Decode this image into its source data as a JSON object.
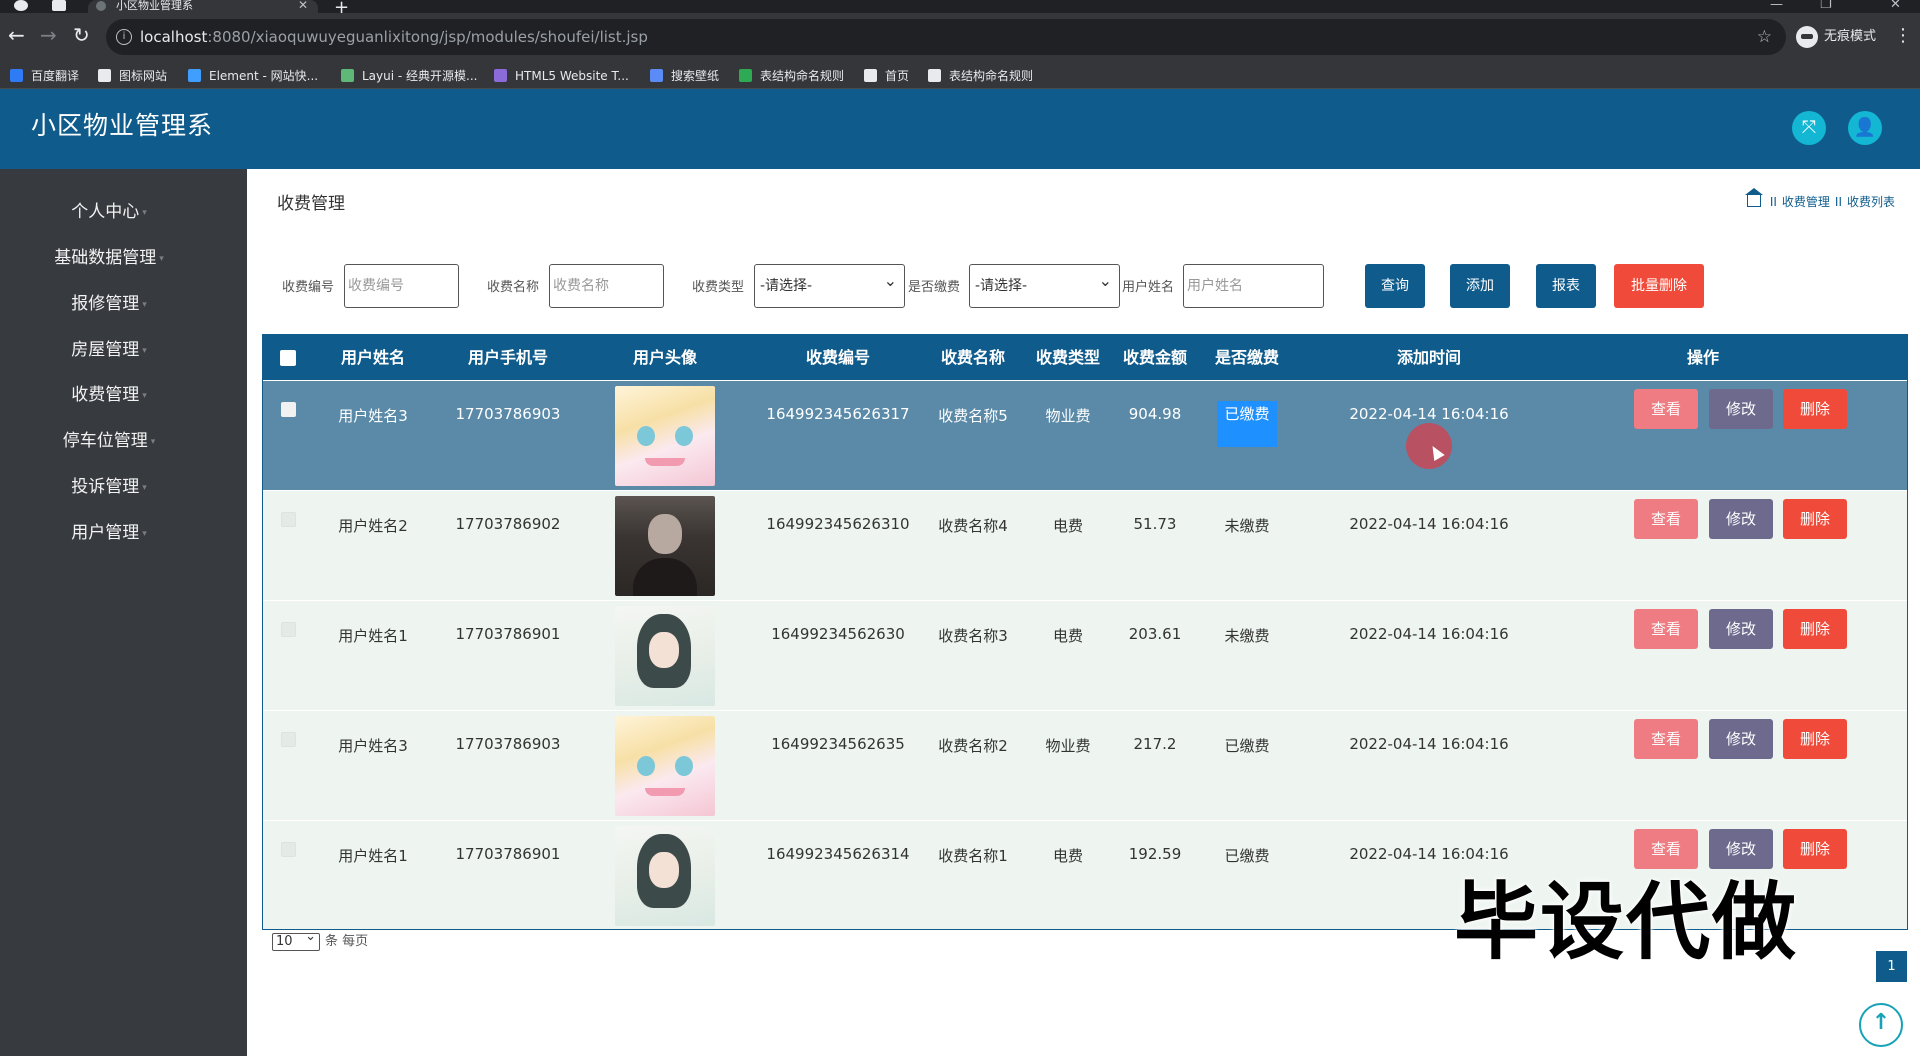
{
  "browser": {
    "tab_title": "小区物业管理系",
    "url_host": "localhost",
    "url_path": ":8080/xiaoquwuyeguanlixitong/jsp/modules/shoufei/list.jsp",
    "incognito_label": "无痕模式",
    "bookmarks": [
      {
        "label": "百度翻译",
        "icon": "translate-icon",
        "color": "#2f7bf6"
      },
      {
        "label": "图标网站",
        "icon": "flag-icon",
        "color": "#e8eaed"
      },
      {
        "label": "Element - 网站快...",
        "icon": "element-icon",
        "color": "#409eff"
      },
      {
        "label": "Layui - 经典开源模...",
        "icon": "layui-icon",
        "color": "#5fb878"
      },
      {
        "label": "HTML5 Website T...",
        "icon": "html5-icon",
        "color": "#8a6bd8"
      },
      {
        "label": "搜索壁纸",
        "icon": "wallpaper-icon",
        "color": "#5b8bf7"
      },
      {
        "label": "表结构命名规则",
        "icon": "sheet-icon",
        "color": "#2eaa55"
      },
      {
        "label": "首页",
        "icon": "globe-icon",
        "color": "#e8eaed"
      },
      {
        "label": "表结构命名规则",
        "icon": "globe-icon",
        "color": "#e8eaed"
      }
    ]
  },
  "app": {
    "title": "小区物业管理系"
  },
  "sidebar": {
    "items": [
      {
        "label": "个人中心"
      },
      {
        "label": "基础数据管理"
      },
      {
        "label": "报修管理"
      },
      {
        "label": "房屋管理"
      },
      {
        "label": "收费管理"
      },
      {
        "label": "停车位管理"
      },
      {
        "label": "投诉管理"
      },
      {
        "label": "用户管理"
      }
    ]
  },
  "page": {
    "title": "收费管理",
    "breadcrumb": [
      "收费管理",
      "收费列表"
    ]
  },
  "filters": {
    "code_label": "收费编号",
    "code_placeholder": "收费编号",
    "name_label": "收费名称",
    "name_placeholder": "收费名称",
    "type_label": "收费类型",
    "type_value": "-请选择-",
    "paid_label": "是否缴费",
    "paid_value": "-请选择-",
    "user_label": "用户姓名",
    "user_placeholder": "用户姓名",
    "search_button": "查询",
    "add_button": "添加",
    "report_button": "报表",
    "batch_delete_button": "批量删除"
  },
  "table": {
    "columns": [
      "用户姓名",
      "用户手机号",
      "用户头像",
      "收费编号",
      "收费名称",
      "收费类型",
      "收费金额",
      "是否缴费",
      "添加时间",
      "操作"
    ],
    "rows": [
      {
        "user": "用户姓名3",
        "phone": "17703786903",
        "avatar": "blonde-anime-avatar",
        "code": "164992345626317",
        "name": "收费名称5",
        "type": "物业费",
        "amount": "904.98",
        "paid": "已缴费",
        "time": "2022-04-14 16:04:16",
        "selected": true
      },
      {
        "user": "用户姓名2",
        "phone": "17703786902",
        "avatar": "man-photo-avatar",
        "code": "164992345626310",
        "name": "收费名称4",
        "type": "电费",
        "amount": "51.73",
        "paid": "未缴费",
        "time": "2022-04-14 16:04:16",
        "selected": false
      },
      {
        "user": "用户姓名1",
        "phone": "17703786901",
        "avatar": "girl-illustration-avatar",
        "code": "16499234562630",
        "name": "收费名称3",
        "type": "电费",
        "amount": "203.61",
        "paid": "未缴费",
        "time": "2022-04-14 16:04:16",
        "selected": false
      },
      {
        "user": "用户姓名3",
        "phone": "17703786903",
        "avatar": "blonde-anime-avatar",
        "code": "16499234562635",
        "name": "收费名称2",
        "type": "物业费",
        "amount": "217.2",
        "paid": "已缴费",
        "time": "2022-04-14 16:04:16",
        "selected": false
      },
      {
        "user": "用户姓名1",
        "phone": "17703786901",
        "avatar": "girl-illustration-avatar",
        "code": "164992345626314",
        "name": "收费名称1",
        "type": "电费",
        "amount": "192.59",
        "paid": "已缴费",
        "time": "2022-04-14 16:04:16",
        "selected": false
      }
    ],
    "actions": {
      "view": "查看",
      "edit": "修改",
      "delete": "删除"
    }
  },
  "pagination": {
    "page_size": "10",
    "page_size_suffix": "条 每页",
    "current_page": "1"
  },
  "overlay": {
    "watermark": "毕设代做"
  },
  "colors": {
    "brand": "#0f5c8c",
    "danger": "#f04b3a",
    "view": "#ef7c82",
    "edit": "#6e6a8e",
    "paid_tag": "#1e90ff"
  }
}
